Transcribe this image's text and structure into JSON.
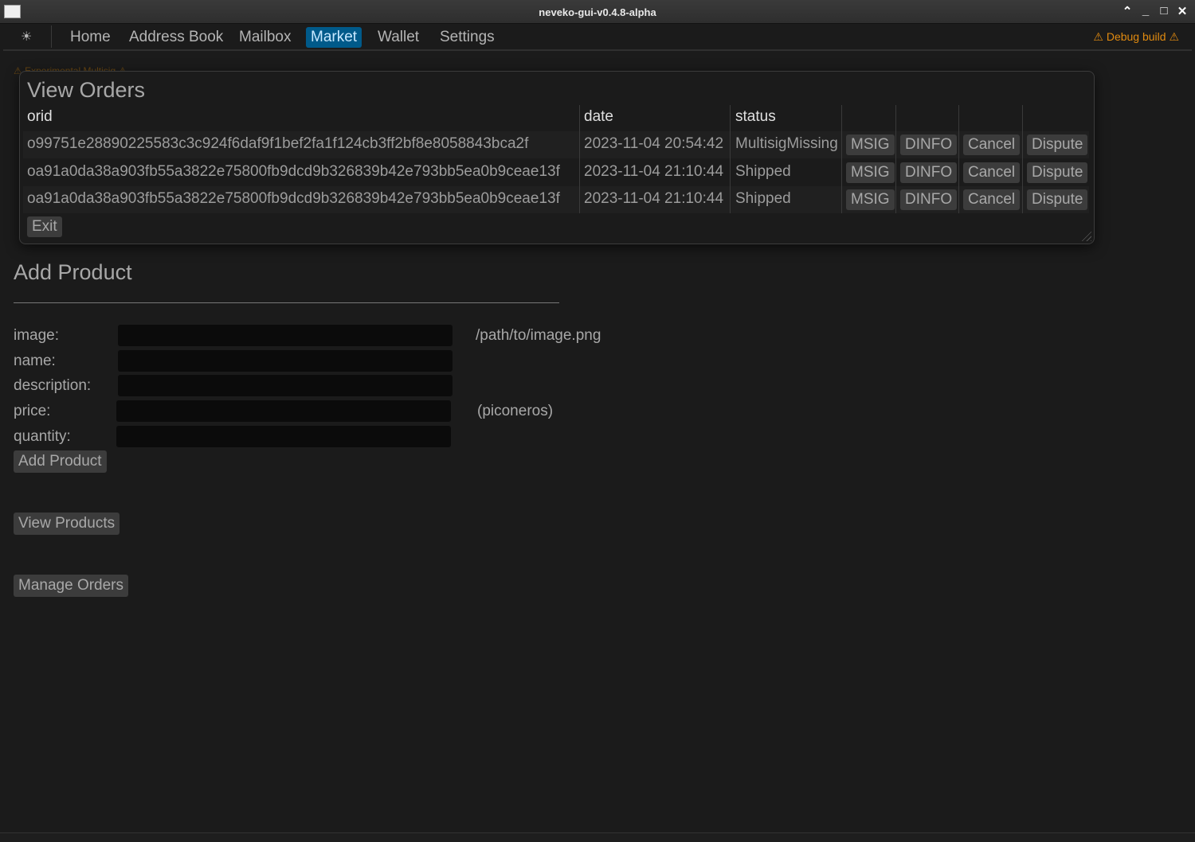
{
  "window": {
    "title": "neveko-gui-v0.4.8-alpha"
  },
  "menu": {
    "theme_icon": "sun-icon",
    "items": [
      "Home",
      "Address Book",
      "Mailbox",
      "Market",
      "Wallet",
      "Settings"
    ],
    "active": "Market",
    "debug": "⚠ Debug build ⚠"
  },
  "background": {
    "warning": "⚠ Experimental Multisig ⚠"
  },
  "orders": {
    "title": "View Orders",
    "headers": [
      "orid",
      "date",
      "status"
    ],
    "rows": [
      {
        "orid": "o99751e28890225583c3c924f6daf9f1bef2fa1f124cb3ff2bf8e8058843bca2f",
        "date": "2023-11-04 20:54:42",
        "status": "MultisigMissing"
      },
      {
        "orid": "oa91a0da38a903fb55a3822e75800fb9dcd9b326839b42e793bb5ea0b9ceae13f",
        "date": "2023-11-04 21:10:44",
        "status": "Shipped"
      },
      {
        "orid": "oa91a0da38a903fb55a3822e75800fb9dcd9b326839b42e793bb5ea0b9ceae13f",
        "date": "2023-11-04 21:10:44",
        "status": "Shipped"
      }
    ],
    "actions": [
      "MSIG",
      "DINFO",
      "Cancel",
      "Dispute"
    ],
    "exit": "Exit"
  },
  "add_product": {
    "title": "Add Product",
    "fields": [
      {
        "label": "image:",
        "value": "",
        "hint": "/path/to/image.png"
      },
      {
        "label": "name:",
        "value": "",
        "hint": ""
      },
      {
        "label": "description:",
        "value": "",
        "hint": ""
      },
      {
        "label": "price:",
        "value": "",
        "hint": "(piconeros)"
      },
      {
        "label": "quantity:",
        "value": "",
        "hint": ""
      }
    ],
    "submit": "Add Product"
  },
  "view_products": "View Products",
  "manage_orders": "Manage Orders",
  "colors": {
    "accent": "#005a8a",
    "warning": "#e08a10",
    "background": "#1b1b1b"
  }
}
